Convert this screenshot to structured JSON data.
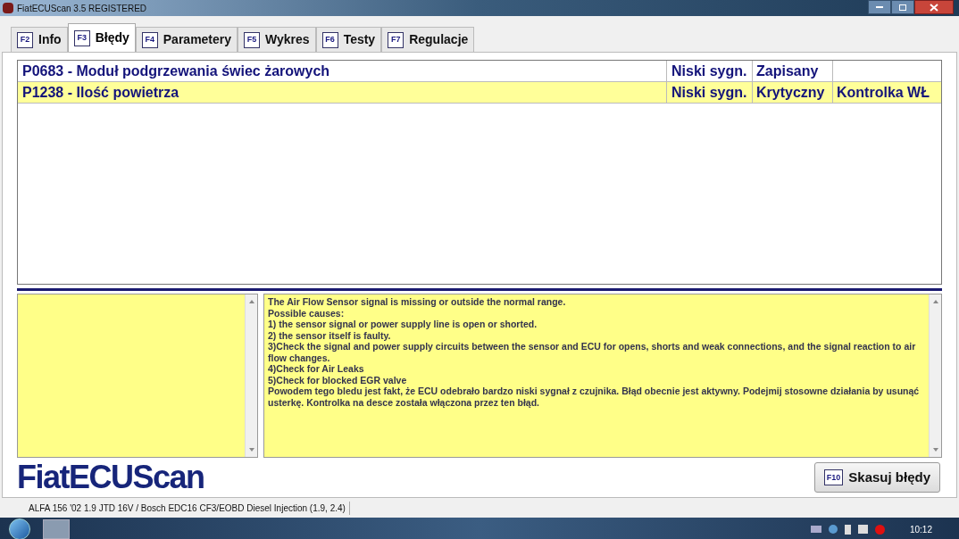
{
  "window": {
    "title": "FiatECUScan 3.5 REGISTERED"
  },
  "tabs": [
    {
      "key": "F2",
      "label": "Info",
      "selected": false
    },
    {
      "key": "F3",
      "label": "Błędy",
      "selected": true
    },
    {
      "key": "F4",
      "label": "Parametery",
      "selected": false
    },
    {
      "key": "F5",
      "label": "Wykres",
      "selected": false
    },
    {
      "key": "F6",
      "label": "Testy",
      "selected": false
    },
    {
      "key": "F7",
      "label": "Regulacje",
      "selected": false
    }
  ],
  "faults": [
    {
      "description": "P0683 - Moduł podgrzewania świec żarowych",
      "signal": "Niski sygn.",
      "status": "Zapisany",
      "selected": false
    },
    {
      "description": "P1238 - Ilość powietrza",
      "signal": "Niski sygn.",
      "status": "Krytyczny",
      "lamp": "Kontrolka WŁ",
      "selected": true
    }
  ],
  "details": [
    "The Air Flow Sensor signal is missing or outside the normal range.",
    "Possible causes:",
    "1) the sensor signal or power supply line is open or shorted.",
    "2) the sensor itself is faulty.",
    "3)Check the signal and power supply circuits between the sensor and ECU for opens, shorts and weak connections, and the signal reaction to air flow changes.",
    "4)Check for Air Leaks",
    "5)Check for blocked EGR valve",
    "Powodem tego bledu jest fakt, że ECU odebrało bardzo niski sygnał z czujnika. Błąd obecnie jest aktywny. Podejmij stosowne działania by usunąć usterkę. Kontrolka na desce została włączona przez ten błąd."
  ],
  "logo": "FiatECUScan",
  "clear_button": {
    "key": "F10",
    "label": "Skasuj błędy"
  },
  "status_bar": "ALFA 156 '02 1.9 JTD 16V / Bosch EDC16 CF3/EOBD Diesel Injection (1.9, 2.4)",
  "taskbar": {
    "clock": "10:12"
  }
}
